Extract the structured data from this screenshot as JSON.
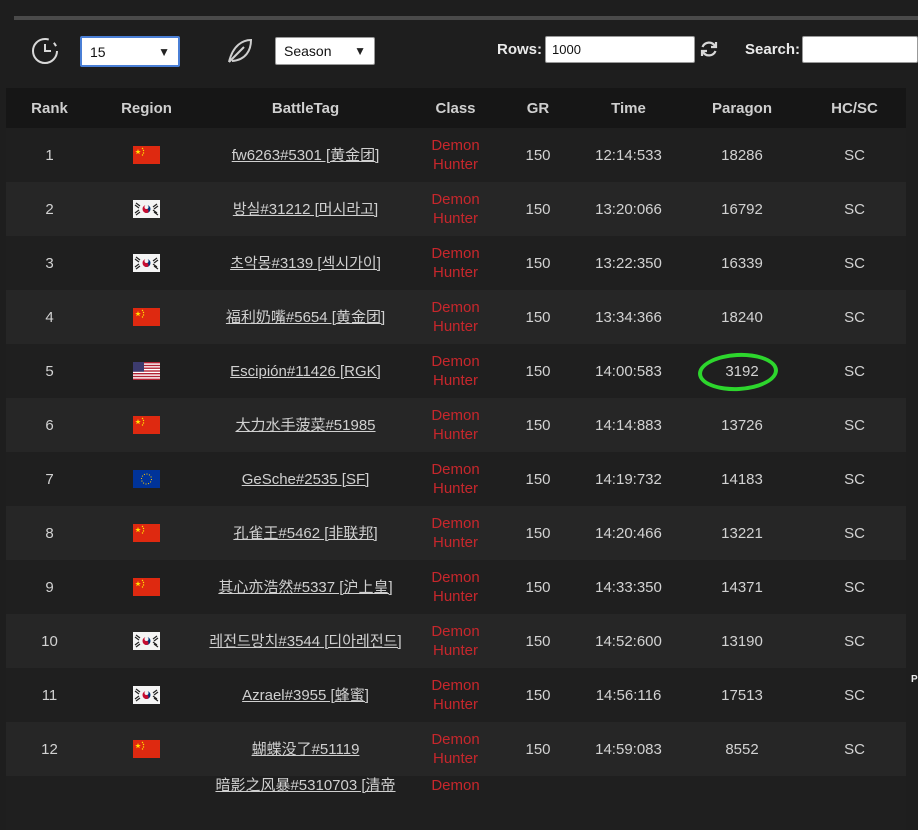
{
  "filters": {
    "time_select": "15",
    "type_select": "Season",
    "rows_label": "Rows:",
    "rows_value": "1000",
    "search_label": "Search:",
    "search_value": ""
  },
  "headers": [
    "Rank",
    "Region",
    "BattleTag",
    "Class",
    "GR",
    "Time",
    "Paragon",
    "HC/SC"
  ],
  "rows": [
    {
      "rank": "1",
      "region": "cn",
      "battletag": "fw6263#5301 [黄金团]",
      "class1": "Demon",
      "class2": "Hunter",
      "gr": "150",
      "time": "12:14:533",
      "paragon": "18286",
      "mode": "SC"
    },
    {
      "rank": "2",
      "region": "kr",
      "battletag": "방실#31212 [머시라고]",
      "class1": "Demon",
      "class2": "Hunter",
      "gr": "150",
      "time": "13:20:066",
      "paragon": "16792",
      "mode": "SC"
    },
    {
      "rank": "3",
      "region": "kr",
      "battletag": "초악몽#3139 [섹시가이]",
      "class1": "Demon",
      "class2": "Hunter",
      "gr": "150",
      "time": "13:22:350",
      "paragon": "16339",
      "mode": "SC"
    },
    {
      "rank": "4",
      "region": "cn",
      "battletag": "福利奶嘴#5654 [黄金团]",
      "class1": "Demon",
      "class2": "Hunter",
      "gr": "150",
      "time": "13:34:366",
      "paragon": "18240",
      "mode": "SC"
    },
    {
      "rank": "5",
      "region": "us",
      "battletag": "Escipión#11426 [RGK]",
      "class1": "Demon",
      "class2": "Hunter",
      "gr": "150",
      "time": "14:00:583",
      "paragon": "3192",
      "mode": "SC"
    },
    {
      "rank": "6",
      "region": "cn",
      "battletag": "大力水手菠菜#51985",
      "class1": "Demon",
      "class2": "Hunter",
      "gr": "150",
      "time": "14:14:883",
      "paragon": "13726",
      "mode": "SC"
    },
    {
      "rank": "7",
      "region": "eu",
      "battletag": "GeSche#2535 [SF]",
      "class1": "Demon",
      "class2": "Hunter",
      "gr": "150",
      "time": "14:19:732",
      "paragon": "14183",
      "mode": "SC"
    },
    {
      "rank": "8",
      "region": "cn",
      "battletag": "孔雀王#5462 [非联邦]",
      "class1": "Demon",
      "class2": "Hunter",
      "gr": "150",
      "time": "14:20:466",
      "paragon": "13221",
      "mode": "SC"
    },
    {
      "rank": "9",
      "region": "cn",
      "battletag": "其心亦浩然#5337 [沪上皇]",
      "class1": "Demon",
      "class2": "Hunter",
      "gr": "150",
      "time": "14:33:350",
      "paragon": "14371",
      "mode": "SC"
    },
    {
      "rank": "10",
      "region": "kr",
      "battletag": "레전드망치#3544 [디아레전드]",
      "class1": "Demon",
      "class2": "Hunter",
      "gr": "150",
      "time": "14:52:600",
      "paragon": "13190",
      "mode": "SC"
    },
    {
      "rank": "11",
      "region": "kr",
      "battletag": "Azrael#3955 [蜂蜜]",
      "class1": "Demon",
      "class2": "Hunter",
      "gr": "150",
      "time": "14:56:116",
      "paragon": "17513",
      "mode": "SC"
    },
    {
      "rank": "12",
      "region": "cn",
      "battletag": "蝴蝶没了#51119",
      "class1": "Demon",
      "class2": "Hunter",
      "gr": "150",
      "time": "14:59:083",
      "paragon": "8552",
      "mode": "SC"
    }
  ],
  "partial_row": {
    "battletag": "暗影之风暴#5310703 [清帝",
    "class1": "Demon"
  },
  "edge_text": "P",
  "highlight_color": "#2dd62d",
  "class_color": "#c7272c"
}
